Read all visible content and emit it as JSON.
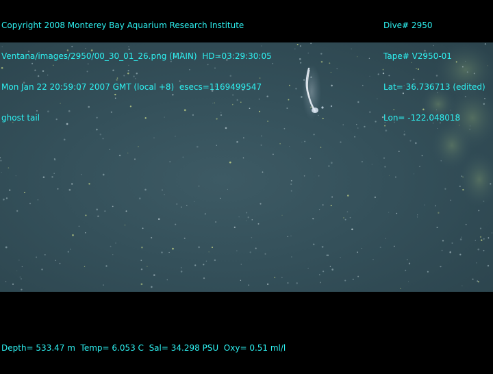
{
  "header_left": {
    "line1": "Copyright 2008 Monterey Bay Aquarium Research Institute",
    "line2": "Ventana/images/2950/00_30_01_26.png (MAIN)  HD=03:29:30:05",
    "line3": "Mon Jan 22 20:59:07 2007 GMT (local +8)  esecs=1169499547",
    "line4": "ghost tail"
  },
  "header_right": {
    "line1": "Dive# 2950",
    "line2": "Tape# V2950-01",
    "line3": "Lat= 36.736713 (edited)",
    "line4": "Lon= -122.048018"
  },
  "footer": {
    "line1": "Depth= 533.47 m  Temp= 6.053 C  Sal= 34.298 PSU  Oxy= 0.51 ml/l"
  },
  "colors": {
    "overlay_text": "#2ef2f2",
    "water": "#34505a",
    "letterbox": "#000000"
  }
}
